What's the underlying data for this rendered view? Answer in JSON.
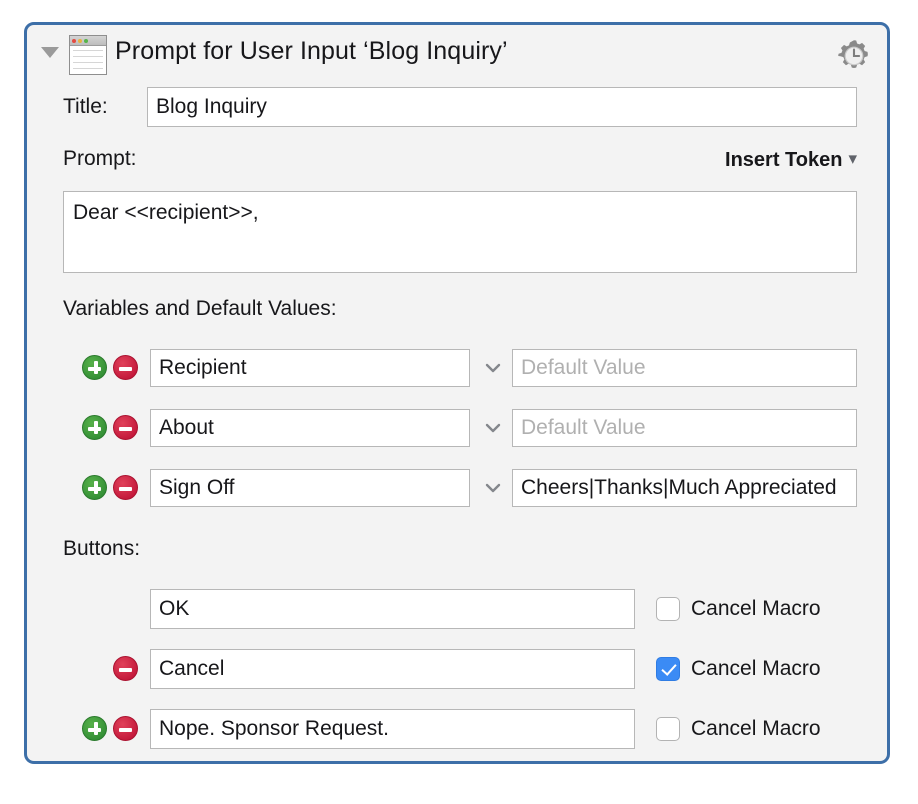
{
  "panel": {
    "header_title": "Prompt for User Input ‘Blog Inquiry’",
    "disclosure_state": "expanded",
    "border_color": "#3d6fa8",
    "background_color": "#f3f3f3",
    "icons": {
      "disclosure": "triangle-down-icon",
      "window": "window-document-icon",
      "gear": "gear-clock-icon"
    }
  },
  "title_row": {
    "label": "Title:",
    "value": "Blog Inquiry",
    "placeholder": ""
  },
  "prompt_row": {
    "label": "Prompt:",
    "insert_token_label": "Insert Token",
    "insert_token_chevron": "⌄",
    "value": "Dear <<recipient>>,",
    "placeholder": ""
  },
  "variables_section": {
    "label": "Variables and Default Values:",
    "default_value_placeholder": "Default Value",
    "rows": [
      {
        "name": "Recipient",
        "default_value": "",
        "has_add": true,
        "has_remove": true,
        "has_dropdown": true
      },
      {
        "name": "About",
        "default_value": "",
        "has_add": true,
        "has_remove": true,
        "has_dropdown": true
      },
      {
        "name": "Sign Off",
        "default_value": "Cheers|Thanks|Much Appreciated",
        "has_add": true,
        "has_remove": true,
        "has_dropdown": true
      }
    ]
  },
  "buttons_section": {
    "label": "Buttons:",
    "cancel_macro_label": "Cancel Macro",
    "rows": [
      {
        "name": "OK",
        "cancel_macro": false,
        "has_add": false,
        "has_remove": false
      },
      {
        "name": "Cancel",
        "cancel_macro": true,
        "has_add": false,
        "has_remove": true
      },
      {
        "name": "Nope. Sponsor Request.",
        "cancel_macro": false,
        "has_add": true,
        "has_remove": true
      }
    ]
  },
  "colors": {
    "add_button": "#3f9a3c",
    "remove_button": "#cf1f3f",
    "checkbox_checked": "#3b8bf5",
    "panel_border": "#3d6fa8"
  }
}
